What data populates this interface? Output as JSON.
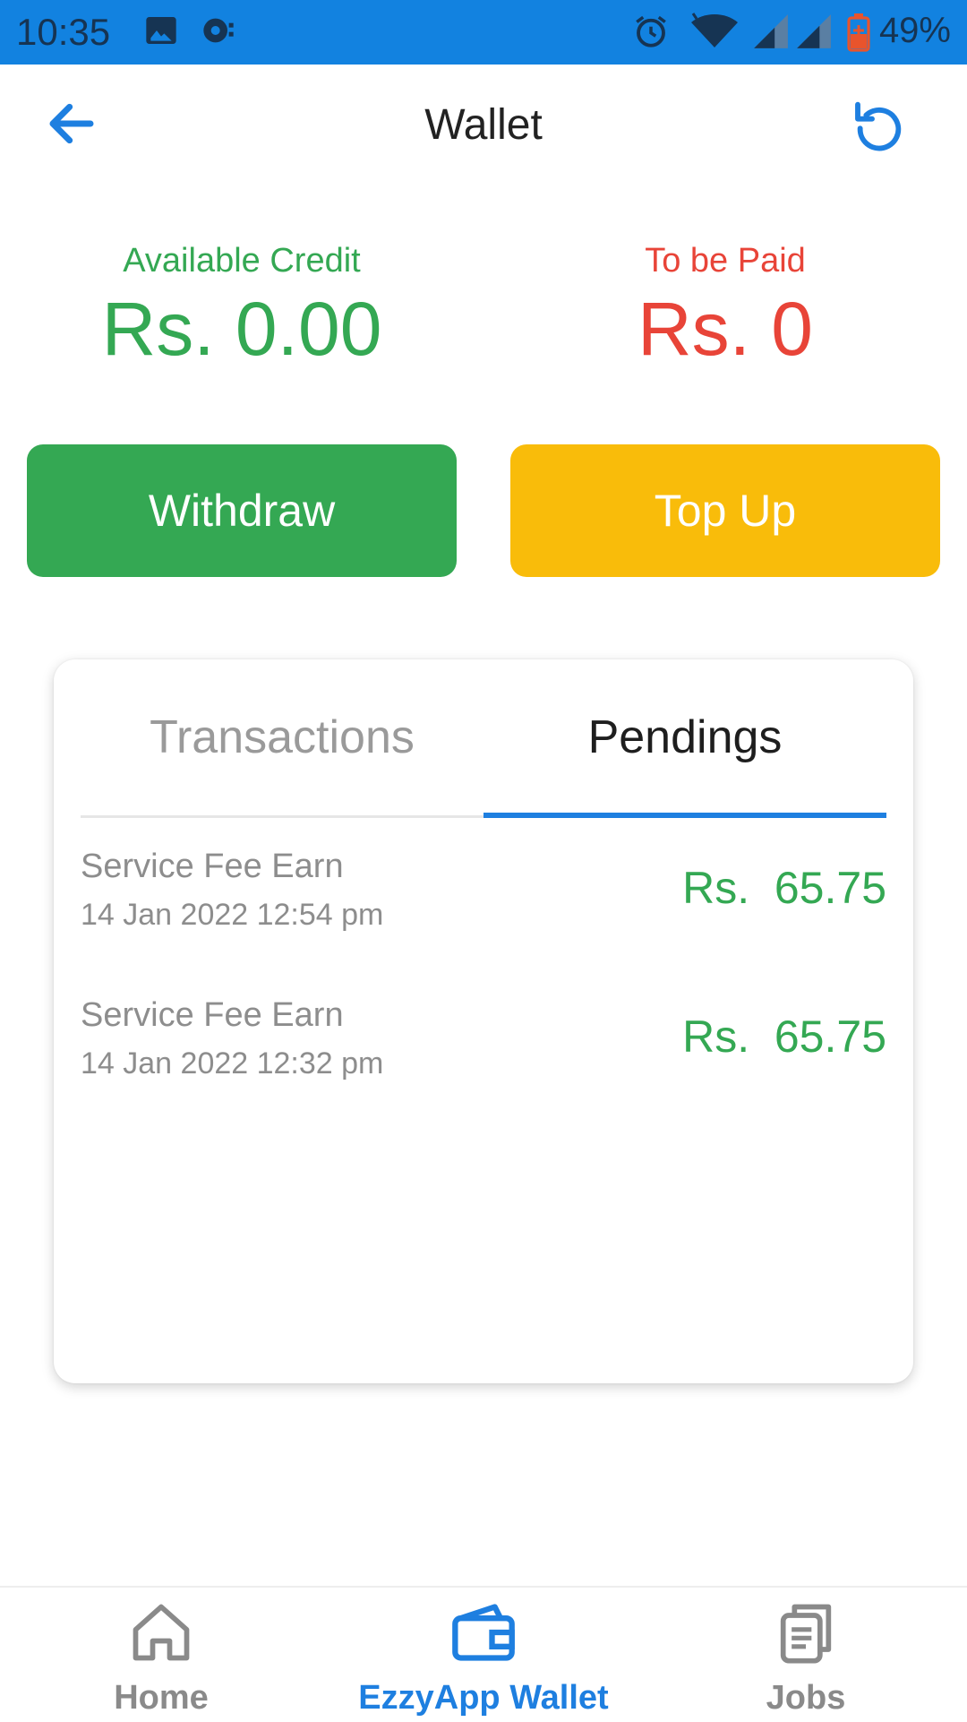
{
  "status_bar": {
    "time": "10:35",
    "battery": "49%",
    "icons": [
      "image-icon",
      "sync-icon",
      "alarm-icon",
      "wifi-icon",
      "signal-icon",
      "signal-icon",
      "battery-icon"
    ]
  },
  "header": {
    "title": "Wallet",
    "back_icon": "arrow-left-icon",
    "refresh_icon": "refresh-icon"
  },
  "summary": {
    "available_label": "Available Credit",
    "available_value": "Rs. 0.00",
    "tobepaid_label": "To be Paid",
    "tobepaid_value": "Rs. 0"
  },
  "actions": {
    "withdraw_label": "Withdraw",
    "topup_label": "Top Up"
  },
  "tabs": [
    {
      "label": "Transactions",
      "active": false
    },
    {
      "label": "Pendings",
      "active": true
    }
  ],
  "pendings": [
    {
      "title": "Service Fee Earn",
      "date": "14 Jan 2022 12:54 pm",
      "amount": "Rs.  65.75"
    },
    {
      "title": "Service Fee Earn",
      "date": "14 Jan 2022 12:32 pm",
      "amount": "Rs.  65.75"
    }
  ],
  "bottom_nav": [
    {
      "label": "Home",
      "icon": "home-icon",
      "active": false
    },
    {
      "label": "EzzyApp Wallet",
      "icon": "wallet-icon",
      "active": true
    },
    {
      "label": "Jobs",
      "icon": "documents-icon",
      "active": false
    }
  ],
  "colors": {
    "statusbar": "#1282e0",
    "accent": "#1e7fe0",
    "green": "#34a853",
    "red": "#e84438",
    "yellow": "#f9bc0a"
  }
}
